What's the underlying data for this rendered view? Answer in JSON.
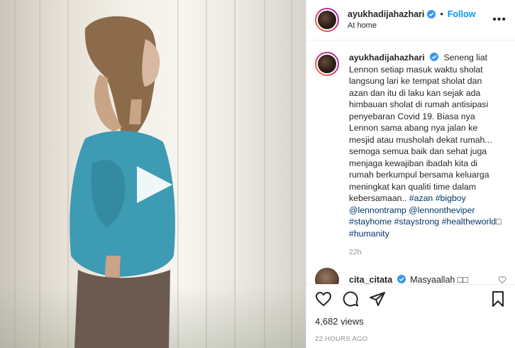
{
  "header": {
    "username": "ayukhadijahazhari",
    "separator": "•",
    "follow_label": "Follow",
    "location": "At home",
    "more_icon": "more-horizontal-icon"
  },
  "caption": {
    "username": "ayukhadijahazhari",
    "text": "Seneng liat Lennon setiap masuk waktu sholat langsung lari ke tempat sholat dan azan dan itu di laku kan sejak ada himbauan sholat di rumah antisipasi penyebaran Covid 19. Biasa nya Lennon sama abang nya jalan ke mesjid atau musholah dekat rumah... semoga semua baik dan sehat juga menjaga kewajiban ibadah kita di rumah berkumpul bersama keluarga meningkat kan qualiti time dalam kebersamaan.. ",
    "hashtags": [
      "#azan",
      "#bigboy",
      "@lennontramp",
      "@lennontheviper",
      "#stayhome",
      "#staystrong",
      "#healtheworld",
      "□",
      "#humanity"
    ],
    "time_ago": "22h"
  },
  "comment": {
    "username": "cita_citata",
    "text": "Masyaallah □□"
  },
  "stats": {
    "views": "4,682 views",
    "timestamp": "22 HOURS AGO"
  },
  "colors": {
    "accent": "#0095f6",
    "verified": "#3897f0",
    "link": "#00376b",
    "muted": "#8e8e8e"
  }
}
